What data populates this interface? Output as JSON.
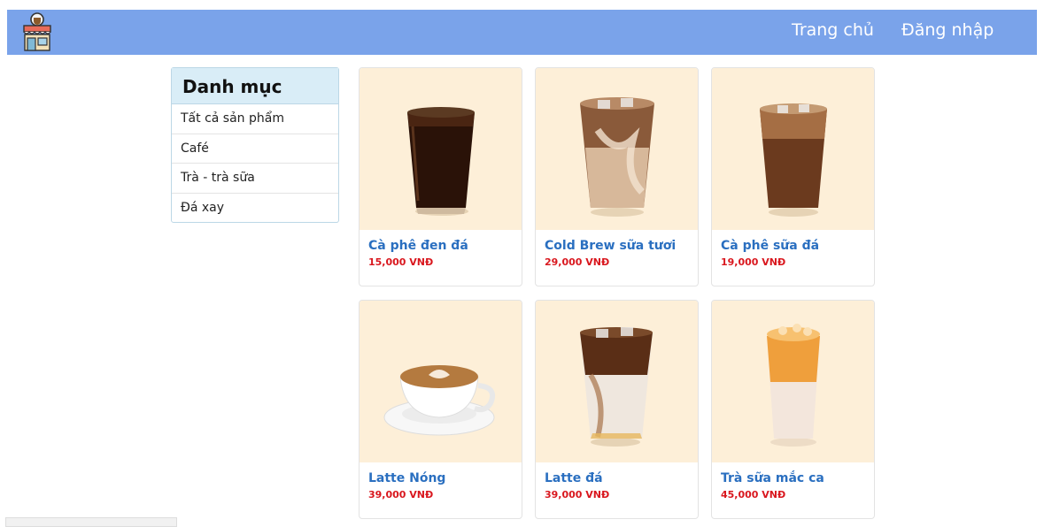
{
  "nav": {
    "home_label": "Trang chủ",
    "login_label": "Đăng nhập",
    "logo_icon": "coffee-shop-icon",
    "bg_color": "#7aa3ea"
  },
  "sidebar": {
    "title": "Danh mục",
    "items": [
      {
        "label": "Tất cả sản phẩm"
      },
      {
        "label": "Café"
      },
      {
        "label": "Trà - trà sữa"
      },
      {
        "label": "Đá xay"
      }
    ]
  },
  "products": [
    {
      "name": "Cà phê đen đá",
      "price": "15,000 VNĐ",
      "image": "black-iced-coffee"
    },
    {
      "name": "Cold Brew sữa tươi",
      "price": "29,000 VNĐ",
      "image": "cold-brew-milk"
    },
    {
      "name": "Cà phê sữa đá",
      "price": "19,000 VNĐ",
      "image": "iced-milk-coffee"
    },
    {
      "name": "Latte Nóng",
      "price": "39,000 VNĐ",
      "image": "hot-latte-cup"
    },
    {
      "name": "Latte đá",
      "price": "39,000 VNĐ",
      "image": "iced-latte"
    },
    {
      "name": "Trà sữa mắc ca",
      "price": "45,000 VNĐ",
      "image": "macadamia-milk-tea"
    }
  ],
  "colors": {
    "title": "#2a6fc0",
    "price": "#d9171e",
    "card_image_bg": "#fdefd8"
  }
}
